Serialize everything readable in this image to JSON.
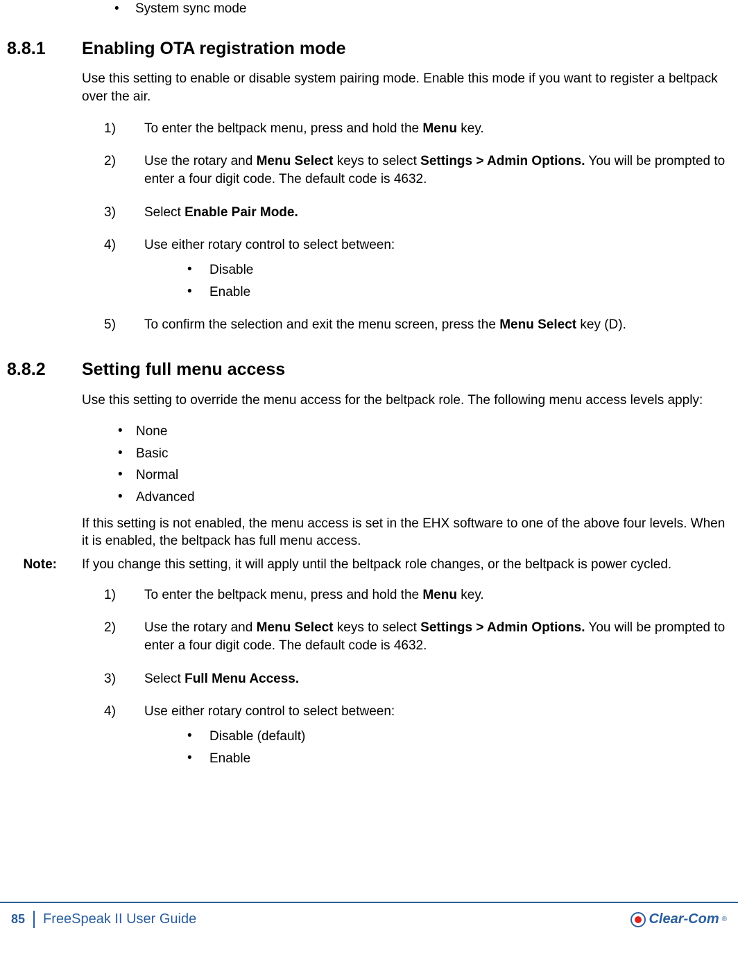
{
  "top_bullet": "System sync mode",
  "sec1": {
    "num": "8.8.1",
    "title": "Enabling OTA registration mode",
    "intro": "Use this setting to enable or disable system pairing mode. Enable this mode if you want to register a beltpack over the air.",
    "steps": {
      "s1": {
        "marker": "1)",
        "pre": "To enter the beltpack menu, press and hold the ",
        "b": "Menu",
        "post": " key."
      },
      "s2": {
        "marker": "2)",
        "pre": "Use the rotary and ",
        "b1": "Menu Select",
        "mid": " keys to select ",
        "b2": "Settings > Admin Options.",
        "post": " You will be prompted to enter a four digit code. The default code is 4632."
      },
      "s3": {
        "marker": "3)",
        "pre": "Select ",
        "b": "Enable Pair Mode."
      },
      "s4": {
        "marker": "4)",
        "text": "Use either rotary control to select between:",
        "opt1": "Disable",
        "opt2": "Enable"
      },
      "s5": {
        "marker": "5)",
        "pre": "To confirm the selection and exit the menu screen, press the ",
        "b": "Menu Select",
        "post": " key (D)."
      }
    }
  },
  "sec2": {
    "num": "8.8.2",
    "title": "Setting full menu access",
    "intro": "Use this setting to override the menu access for the beltpack role. The following menu access levels apply:",
    "levels": {
      "l1": "None",
      "l2": "Basic",
      "l3": "Normal",
      "l4": "Advanced"
    },
    "para2": "If this setting is not enabled, the menu access is set in the EHX software to one of the above four levels. When it is enabled, the beltpack has full menu access.",
    "note_label": "Note:",
    "note_text": "If you change this setting, it will apply until the beltpack role changes, or the beltpack is power cycled.",
    "steps": {
      "s1": {
        "marker": "1)",
        "pre": "To enter the beltpack menu, press and hold the ",
        "b": "Menu",
        "post": " key."
      },
      "s2": {
        "marker": "2)",
        "pre": "Use the rotary and ",
        "b1": "Menu Select",
        "mid": " keys to select ",
        "b2": "Settings > Admin Options.",
        "post": " You will be prompted to enter a four digit code. The default code is 4632."
      },
      "s3": {
        "marker": "3)",
        "pre": "Select ",
        "b": "Full Menu Access."
      },
      "s4": {
        "marker": "4)",
        "text": "Use either rotary control to select between:",
        "opt1": "Disable (default)",
        "opt2": "Enable"
      }
    }
  },
  "footer": {
    "page": "85",
    "title": "FreeSpeak II User Guide",
    "brand": "Clear-Com"
  }
}
